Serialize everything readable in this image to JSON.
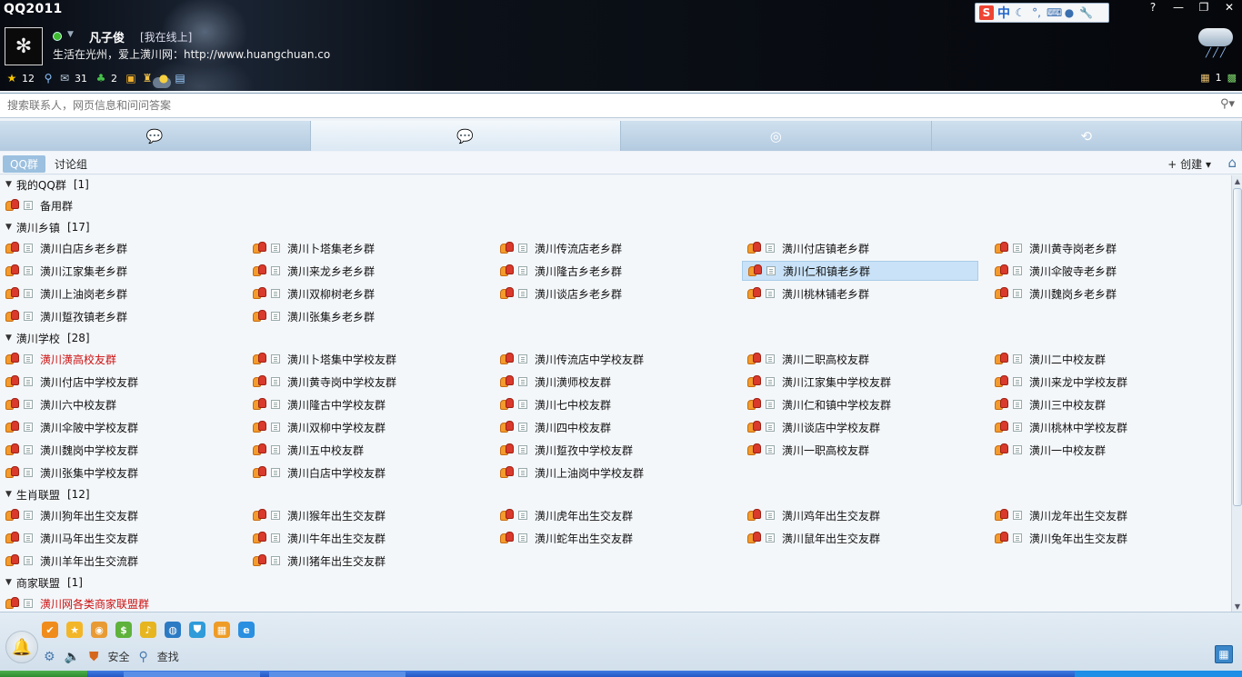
{
  "app": {
    "title": "QQ2011"
  },
  "profile": {
    "nickname": "凡子俊",
    "status": "[我在线上]",
    "signature": "生活在光州，爱上潢川网：http://www.huangchuan.co"
  },
  "header_counters": [
    {
      "icon": "star-icon",
      "count": "12"
    },
    {
      "icon": "search-zone-icon",
      "count": ""
    },
    {
      "icon": "mail-icon",
      "count": "31"
    },
    {
      "icon": "clover-icon",
      "count": "2"
    },
    {
      "icon": "pet-icon",
      "count": ""
    },
    {
      "icon": "bag-icon",
      "count": ""
    },
    {
      "icon": "coin-icon",
      "count": ""
    },
    {
      "icon": "news-icon",
      "count": ""
    }
  ],
  "header_right": {
    "mailbox_count": "1"
  },
  "ime": {
    "mode": "中"
  },
  "search": {
    "placeholder": "搜索联系人，网页信息和问问答案"
  },
  "subtabs": {
    "qq_group": "QQ群",
    "discussion": "讨论组",
    "create": "创建"
  },
  "groups": [
    {
      "title": "我的QQ群",
      "count": "[1]",
      "items": [
        "备用群"
      ]
    },
    {
      "title": "潢川乡镇",
      "count": "[17]",
      "items": [
        "潢川白店乡老乡群",
        "潢川卜塔集老乡群",
        "潢川传流店老乡群",
        "潢川付店镇老乡群",
        "潢川黄寺岗老乡群",
        "潢川江家集老乡群",
        "潢川来龙乡老乡群",
        "潢川隆古乡老乡群",
        "潢川仁和镇老乡群",
        "潢川伞陂寺老乡群",
        "潢川上油岗老乡群",
        "潢川双柳树老乡群",
        "潢川谈店乡老乡群",
        "潢川桃林铺老乡群",
        "潢川魏岗乡老乡群",
        "潢川踅孜镇老乡群",
        "潢川张集乡老乡群"
      ]
    },
    {
      "title": "潢川学校",
      "count": "[28]",
      "items": [
        "潢川潢高校友群",
        "潢川卜塔集中学校友群",
        "潢川传流店中学校友群",
        "潢川二职高校友群",
        "潢川二中校友群",
        "潢川付店中学校友群",
        "潢川黄寺岗中学校友群",
        "潢川潢师校友群",
        "潢川江家集中学校友群",
        "潢川来龙中学校友群",
        "潢川六中校友群",
        "潢川隆古中学校友群",
        "潢川七中校友群",
        "潢川仁和镇中学校友群",
        "潢川三中校友群",
        "潢川伞陂中学校友群",
        "潢川双柳中学校友群",
        "潢川四中校友群",
        "潢川谈店中学校友群",
        "潢川桃林中学校友群",
        "潢川魏岗中学校友群",
        "潢川五中校友群",
        "潢川踅孜中学校友群",
        "潢川一职高校友群",
        "潢川一中校友群",
        "潢川张集中学校友群",
        "潢川白店中学校友群",
        "潢川上油岗中学校友群"
      ]
    },
    {
      "title": "生肖联盟",
      "count": "[12]",
      "items": [
        "潢川狗年出生交友群",
        "潢川猴年出生交友群",
        "潢川虎年出生交友群",
        "潢川鸡年出生交友群",
        "潢川龙年出生交友群",
        "潢川马年出生交友群",
        "潢川牛年出生交友群",
        "潢川蛇年出生交友群",
        "潢川鼠年出生交友群",
        "潢川兔年出生交友群",
        "潢川羊年出生交流群",
        "潢川猪年出生交友群"
      ]
    },
    {
      "title": "商家联盟",
      "count": "[1]",
      "items": [
        "潢川网各类商家联盟群"
      ]
    }
  ],
  "highlight": {
    "selected": "潢川仁和镇老乡群",
    "red": [
      "潢川潢高校友群",
      "潢川网各类商家联盟群"
    ]
  },
  "bottom": {
    "security_label": "安全",
    "find_label": "查找"
  },
  "colors": {
    "selected_bg": "#c9e2f7",
    "red_text": "#cc1111",
    "accent": "#4a87c3"
  }
}
